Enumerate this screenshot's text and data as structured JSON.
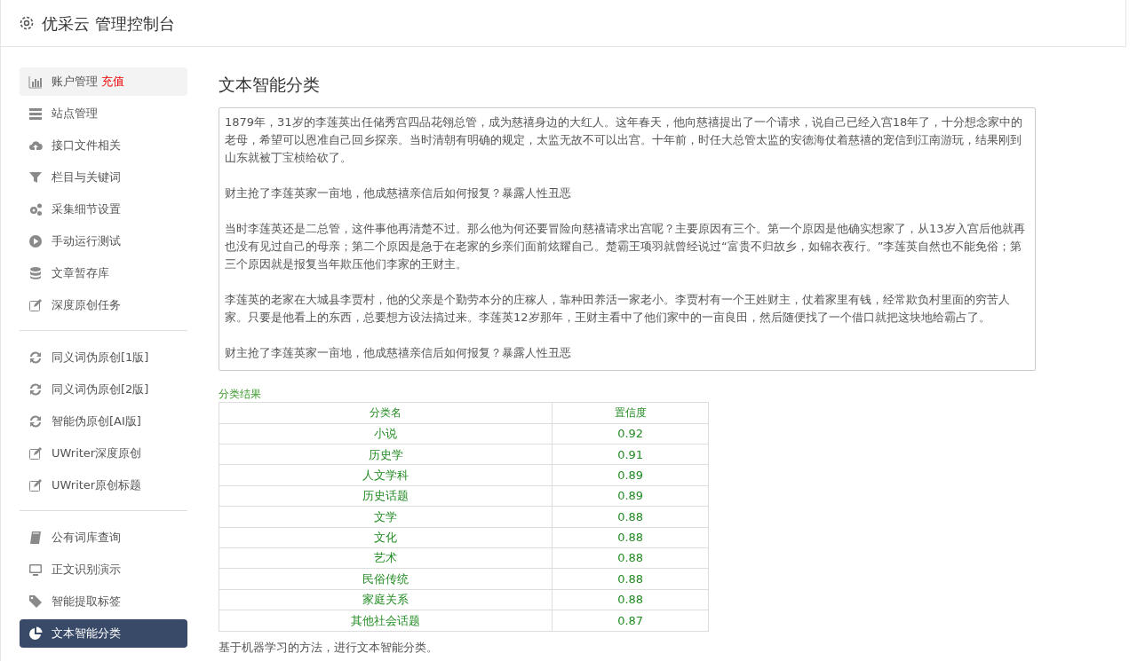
{
  "header": {
    "title": "优采云 管理控制台"
  },
  "sidebar": {
    "groups": [
      [
        {
          "label": "账户管理",
          "badge": "充值",
          "selected": false,
          "hover": true
        },
        {
          "label": "站点管理",
          "selected": false
        },
        {
          "label": "接口文件相关",
          "selected": false
        },
        {
          "label": "栏目与关键词",
          "selected": false
        },
        {
          "label": "采集细节设置",
          "selected": false
        },
        {
          "label": "手动运行测试",
          "selected": false
        },
        {
          "label": "文章暂存库",
          "selected": false
        },
        {
          "label": "深度原创任务",
          "selected": false
        }
      ],
      [
        {
          "label": "同义词伪原创[1版]",
          "selected": false
        },
        {
          "label": "同义词伪原创[2版]",
          "selected": false
        },
        {
          "label": "智能伪原创[AI版]",
          "selected": false
        },
        {
          "label": "UWriter深度原创",
          "selected": false
        },
        {
          "label": "UWriter原创标题",
          "selected": false
        }
      ],
      [
        {
          "label": "公有词库查询",
          "selected": false
        },
        {
          "label": "正文识别演示",
          "selected": false
        },
        {
          "label": "智能提取标签",
          "selected": false
        },
        {
          "label": "文本智能分类",
          "selected": true
        }
      ]
    ]
  },
  "main": {
    "title": "文本智能分类",
    "input": {
      "paragraphs": [
        "1879年，31岁的李莲英出任储秀宫四品花翎总管，成为慈禧身边的大红人。这年春天，他向慈禧提出了一个请求，说自己已经入宫18年了，十分想念家中的老母，希望可以恩准自己回乡探亲。当时清朝有明确的规定，太监无故不可以出宫。十年前，时任大总管太监的安德海仗着慈禧的宠信到江南游玩，结果刚到山东就被丁宝桢给砍了。",
        "财主抢了李莲英家一亩地，他成慈禧亲信后如何报复？暴露人性丑恶",
        "当时李莲英还是二总管，这件事他再清楚不过。那么他为何还要冒险向慈禧请求出宫呢？主要原因有三个。第一个原因是他确实想家了，从13岁入宫后他就再也没有见过自己的母亲；第二个原因是急于在老家的乡亲们面前炫耀自己。楚霸王项羽就曾经说过“富贵不归故乡，如锦衣夜行。”李莲英自然也不能免俗；第三个原因就是报复当年欺压他们李家的王财主。",
        "李莲英的老家在大城县李贾村，他的父亲是个勤劳本分的庄稼人，靠种田养活一家老小。李贾村有一个王姓财主，仗着家里有钱，经常欺负村里面的穷苦人家。只要是他看上的东西，总要想方设法搞过来。李莲英12岁那年，王财主看中了他们家中的一亩良田，然后随便找了一个借口就把这块地给霸占了。",
        "财主抢了李莲英家一亩地，他成慈禧亲信后如何报复？暴露人性丑恶"
      ]
    },
    "result_label": "分类结果",
    "table": {
      "columns": [
        "分类名",
        "置信度"
      ],
      "rows": [
        [
          "小说",
          "0.92"
        ],
        [
          "历史学",
          "0.91"
        ],
        [
          "人文学科",
          "0.89"
        ],
        [
          "历史话题",
          "0.89"
        ],
        [
          "文学",
          "0.88"
        ],
        [
          "文化",
          "0.88"
        ],
        [
          "艺术",
          "0.88"
        ],
        [
          "民俗传统",
          "0.88"
        ],
        [
          "家庭关系",
          "0.88"
        ],
        [
          "其他社会话题",
          "0.87"
        ]
      ]
    },
    "note": "基于机器学习的方法，进行文本智能分类。"
  }
}
